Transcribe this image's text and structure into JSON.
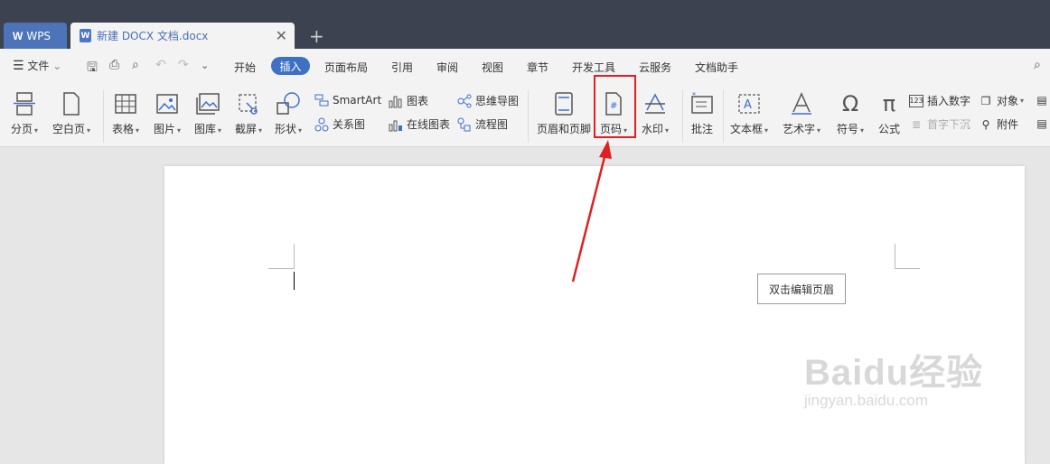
{
  "tabs": {
    "wps": "WPS",
    "document": "新建 DOCX 文档.docx",
    "new_tab": "+"
  },
  "menu": {
    "file": "文件",
    "items": [
      "开始",
      "插入",
      "页面布局",
      "引用",
      "审阅",
      "视图",
      "章节",
      "开发工具",
      "云服务",
      "文档助手"
    ],
    "active": "插入"
  },
  "ribbon": {
    "page_break": "分页",
    "blank_page": "空白页",
    "table": "表格",
    "picture": "图片",
    "gallery": "图库",
    "screenshot": "截屏",
    "shape": "形状",
    "smartart": "SmartArt",
    "chart": "图表",
    "mindmap": "思维导图",
    "relation": "关系图",
    "online_chart": "在线图表",
    "flowchart": "流程图",
    "header_footer": "页眉和页脚",
    "page_number": "页码",
    "watermark": "水印",
    "comment": "批注",
    "textbox": "文本框",
    "wordart": "艺术字",
    "symbol": "符号",
    "formula": "公式",
    "insert_number": "插入数字",
    "dropcap": "首字下沉",
    "object": "对象",
    "attachment": "附件"
  },
  "document": {
    "header_tooltip": "双击编辑页眉"
  },
  "watermark": {
    "line1": "Baidu经验",
    "line2": "jingyan.baidu.com"
  },
  "colors": {
    "accent": "#3e70c4",
    "highlight": "#e02020",
    "titlebar": "#3c4250"
  }
}
